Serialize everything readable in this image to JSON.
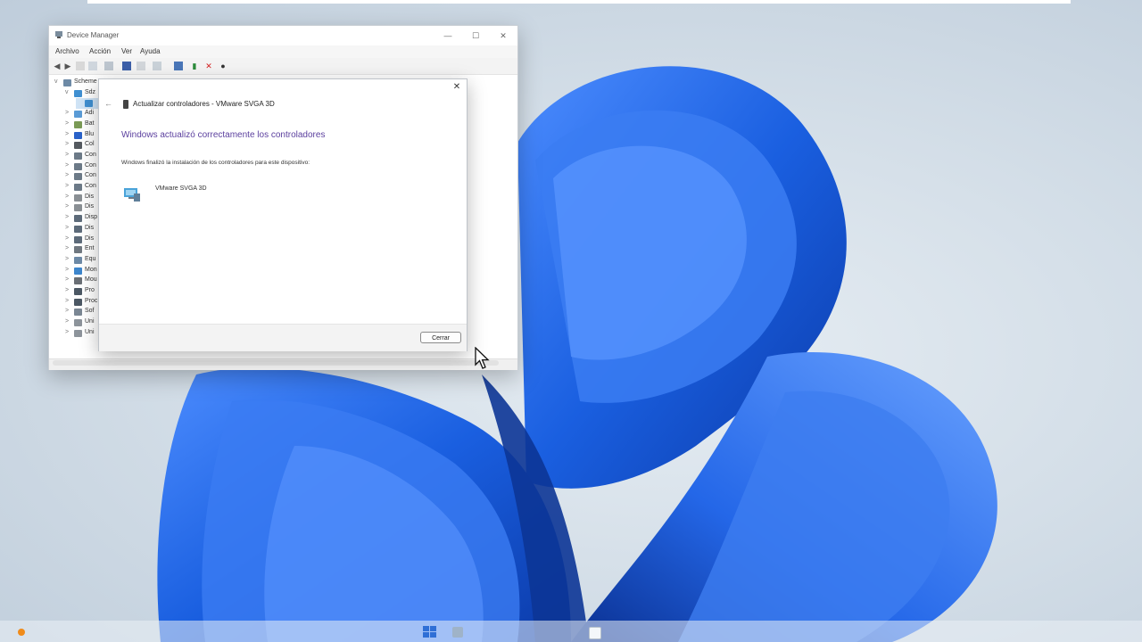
{
  "device_manager": {
    "title": "Device Manager",
    "window_controls": {
      "minimize": "—",
      "maximize": "☐",
      "close": "✕"
    },
    "menu": [
      "Archivo",
      "Acción",
      "Ver",
      "Ayuda"
    ],
    "tree": [
      {
        "label": "Scheme",
        "level": 0,
        "expander": "v",
        "icon": "computer-icon"
      },
      {
        "label": "Sdz",
        "level": 1,
        "expander": "v",
        "icon": "display-adapter-icon"
      },
      {
        "label": "",
        "level": 2,
        "expander": "",
        "icon": "display-adapter-icon"
      },
      {
        "label": "Adi",
        "level": 1,
        "expander": ">",
        "icon": "audio-icon"
      },
      {
        "label": "Bat",
        "level": 1,
        "expander": ">",
        "icon": "battery-icon"
      },
      {
        "label": "Blu",
        "level": 1,
        "expander": ">",
        "icon": "bluetooth-icon"
      },
      {
        "label": "Col",
        "level": 1,
        "expander": ">",
        "icon": "camera-icon"
      },
      {
        "label": "Con",
        "level": 1,
        "expander": ">",
        "icon": "controller-icon"
      },
      {
        "label": "Con",
        "level": 1,
        "expander": ">",
        "icon": "controller-icon"
      },
      {
        "label": "Con",
        "level": 1,
        "expander": ">",
        "icon": "controller-icon"
      },
      {
        "label": "Con",
        "level": 1,
        "expander": ">",
        "icon": "controller-icon"
      },
      {
        "label": "Dis",
        "level": 1,
        "expander": ">",
        "icon": "disk-icon"
      },
      {
        "label": "Dis",
        "level": 1,
        "expander": ">",
        "icon": "disk-icon"
      },
      {
        "label": "Disp",
        "level": 1,
        "expander": ">",
        "icon": "device-icon"
      },
      {
        "label": "Dis",
        "level": 1,
        "expander": ">",
        "icon": "device-icon"
      },
      {
        "label": "Dis",
        "level": 1,
        "expander": ">",
        "icon": "device-icon"
      },
      {
        "label": "Ent",
        "level": 1,
        "expander": ">",
        "icon": "input-icon"
      },
      {
        "label": "Equ",
        "level": 1,
        "expander": ">",
        "icon": "computer-icon"
      },
      {
        "label": "Mon",
        "level": 1,
        "expander": ">",
        "icon": "monitor-icon"
      },
      {
        "label": "Mou",
        "level": 1,
        "expander": ">",
        "icon": "mouse-icon"
      },
      {
        "label": "Pro",
        "level": 1,
        "expander": ">",
        "icon": "processor-icon"
      },
      {
        "label": "Proc",
        "level": 1,
        "expander": ">",
        "icon": "processor-icon"
      },
      {
        "label": "Sof",
        "level": 1,
        "expander": ">",
        "icon": "software-icon"
      },
      {
        "label": "Uni",
        "level": 1,
        "expander": ">",
        "icon": "drive-icon"
      },
      {
        "label": "Uni",
        "level": 1,
        "expander": ">",
        "icon": "drive-icon"
      }
    ]
  },
  "wizard": {
    "close_glyph": "✕",
    "back_glyph": "←",
    "header_title": "Actualizar controladores - VMware SVGA 3D",
    "heading": "Windows actualizó correctamente los controladores",
    "description": "Windows finalizó la instalación de los controladores para este dispositivo:",
    "device_name": "VMware SVGA 3D",
    "close_button": "Cerrar"
  },
  "colors": {
    "heading": "#5b3f9e",
    "wallpaper_blue": "#1a5fe0"
  }
}
